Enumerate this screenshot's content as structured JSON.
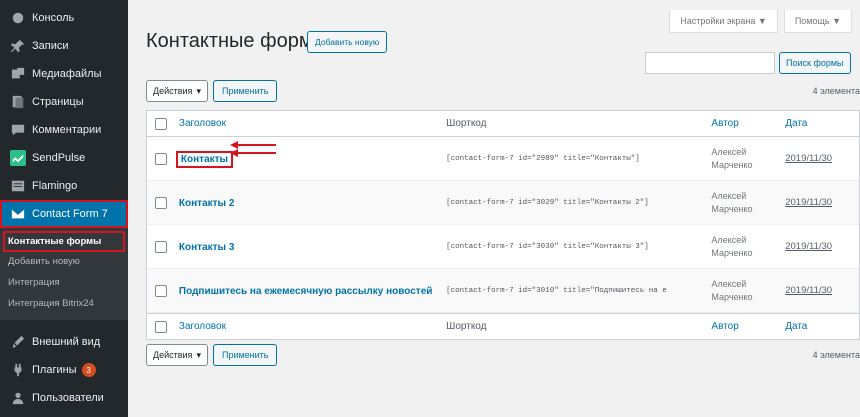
{
  "sidebar": {
    "items": [
      {
        "label": "Консоль",
        "icon": "dashboard-icon"
      },
      {
        "label": "Записи",
        "icon": "pin-icon"
      },
      {
        "label": "Медиафайлы",
        "icon": "media-icon"
      },
      {
        "label": "Страницы",
        "icon": "pages-icon"
      },
      {
        "label": "Комментарии",
        "icon": "comments-icon"
      },
      {
        "label": "SendPulse",
        "icon": "sendpulse-icon"
      },
      {
        "label": "Flamingo",
        "icon": "flamingo-icon"
      },
      {
        "label": "Contact Form 7",
        "icon": "mail-icon"
      }
    ],
    "submenu": [
      {
        "label": "Контактные формы"
      },
      {
        "label": "Добавить новую"
      },
      {
        "label": "Интеграция"
      },
      {
        "label": "Интеграция Bitrix24"
      }
    ],
    "items_bottom": [
      {
        "label": "Внешний вид",
        "icon": "appearance-icon"
      },
      {
        "label": "Плагины",
        "icon": "plugins-icon",
        "badge": "3"
      },
      {
        "label": "Пользователи",
        "icon": "users-icon"
      }
    ]
  },
  "header": {
    "screen_options": "Настройки экрана ▼",
    "help": "Помощь ▼",
    "title": "Контактные формы",
    "add_new": "Добавить новую"
  },
  "search": {
    "button": "Поиск формы",
    "placeholder": ""
  },
  "tablenav": {
    "bulk_actions": "Действия",
    "apply": "Применить",
    "count": "4 элемента"
  },
  "table": {
    "columns": {
      "title": "Заголовок",
      "shortcode": "Шорткод",
      "author": "Автор",
      "date": "Дата"
    },
    "rows": [
      {
        "title": "Контакты",
        "shortcode": "[contact-form-7 id=\"2989\" title=\"Контакты\"]",
        "author_first": "Алексей",
        "author_last": "Марченко",
        "date": "2019/11/30"
      },
      {
        "title": "Контакты 2",
        "shortcode": "[contact-form-7 id=\"3029\" title=\"Контакты 2\"]",
        "author_first": "Алексей",
        "author_last": "Марченко",
        "date": "2019/11/30"
      },
      {
        "title": "Контакты 3",
        "shortcode": "[contact-form-7 id=\"3030\" title=\"Контакты 3\"]",
        "author_first": "Алексей",
        "author_last": "Марченко",
        "date": "2019/11/30"
      },
      {
        "title": "Подпишитесь на ежемесячную рассылку новостей",
        "shortcode": "[contact-form-7 id=\"3010\" title=\"Подпишитесь на е",
        "author_first": "Алексей",
        "author_last": "Марченко",
        "date": "2019/11/30"
      }
    ]
  },
  "colors": {
    "accent": "#0073aa",
    "sidebar_bg": "#23282d",
    "highlight": "#d4151f"
  }
}
